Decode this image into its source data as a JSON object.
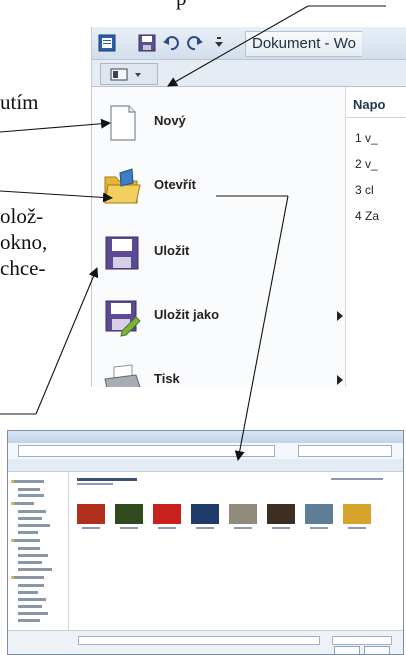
{
  "side_text": {
    "top_fragment": "p",
    "line1": "utím",
    "line2a": "olož-",
    "line2b": "okno,",
    "line2c": "chce-"
  },
  "word_window": {
    "title": "Dokument - Wo",
    "backstage_menu": [
      {
        "label": "Nový",
        "icon": "new-document-icon",
        "submenu": false
      },
      {
        "label": "Otevřít",
        "icon": "open-folder-icon",
        "submenu": false
      },
      {
        "label": "Uložit",
        "icon": "save-icon",
        "submenu": false
      },
      {
        "label": "Uložit jako",
        "icon": "save-as-icon",
        "submenu": true
      },
      {
        "label": "Tisk",
        "icon": "printer-icon",
        "submenu": true
      }
    ],
    "recent_header": "Napo",
    "recent_files": [
      "1  v_",
      "2  v_",
      "3  cl",
      "4  Za"
    ]
  },
  "explorer": {
    "thumbnail_colors": [
      "#b0301c",
      "#2f4a1c",
      "#c8211d",
      "#1e3b6a",
      "#8f8a7a",
      "#3a2f22",
      "#5e7d96",
      "#d6a32b"
    ]
  },
  "colors": {
    "ribbon": "#d3deec",
    "menu_bg": "#fafbfc",
    "label": "#222222"
  }
}
